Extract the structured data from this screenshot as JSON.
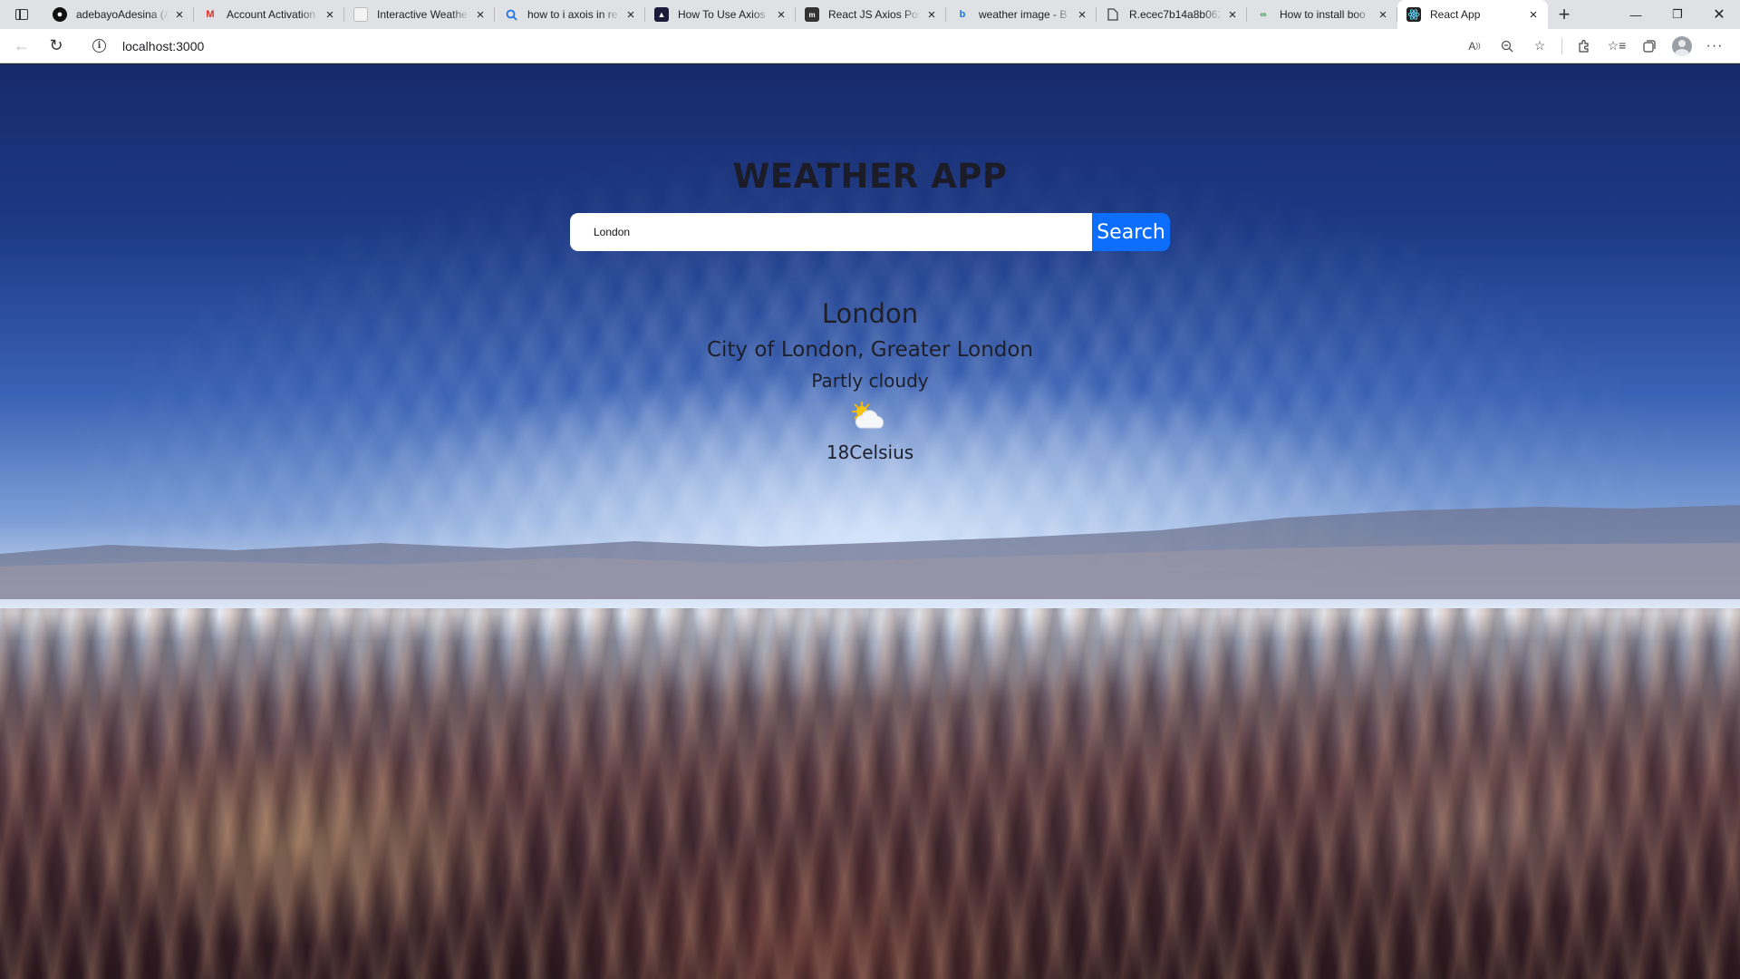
{
  "browser": {
    "tabs": [
      {
        "title": "adebayoAdesina (A",
        "icon": "github-icon"
      },
      {
        "title": "Account Activation",
        "icon": "gmail-icon"
      },
      {
        "title": "Interactive Weathe",
        "icon": "page-icon"
      },
      {
        "title": "how to i axois in re",
        "icon": "search-icon"
      },
      {
        "title": "How To Use Axios",
        "icon": "digitalocean-icon"
      },
      {
        "title": "React JS Axios Pos",
        "icon": "site-icon"
      },
      {
        "title": "weather image - B",
        "icon": "bing-icon"
      },
      {
        "title": "R.ecec7b14a8b062",
        "icon": "document-icon"
      },
      {
        "title": "How to install boo",
        "icon": "site-icon"
      },
      {
        "title": "React App",
        "icon": "react-icon",
        "active": true
      }
    ],
    "address_bar": {
      "url": "localhost:3000"
    }
  },
  "app": {
    "title": "WEATHER APP",
    "search": {
      "value": "London",
      "button_label": "Search"
    },
    "result": {
      "city": "London",
      "region": "City of London, Greater London",
      "condition": "Partly cloudy",
      "icon": "partly-cloudy-icon",
      "temperature": "18Celsius"
    }
  },
  "colors": {
    "search_button": "#0d6efd",
    "text": "#1f1f2a"
  }
}
